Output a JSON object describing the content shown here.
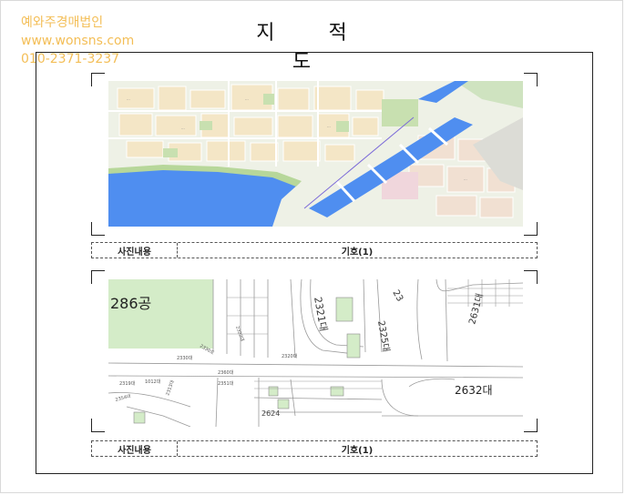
{
  "watermark": {
    "line1": "예와주경매법인",
    "line2": "www.wonsns.com",
    "line3": "010-2371-3237"
  },
  "title": "지 적 도",
  "section1": {
    "caption_left": "사진내용",
    "caption_right": "기호(1)"
  },
  "section2": {
    "caption_left": "사진내용",
    "caption_right": "기호(1)",
    "lot_labels": [
      "286공",
      "2321대",
      "2325대",
      "2631대",
      "2632대",
      "2624",
      "23"
    ]
  },
  "colors": {
    "water": "#4f8ef0",
    "park": "#c8e0b0",
    "watermark": "#f2b33a",
    "parcel_green": "#d4ecc8"
  }
}
